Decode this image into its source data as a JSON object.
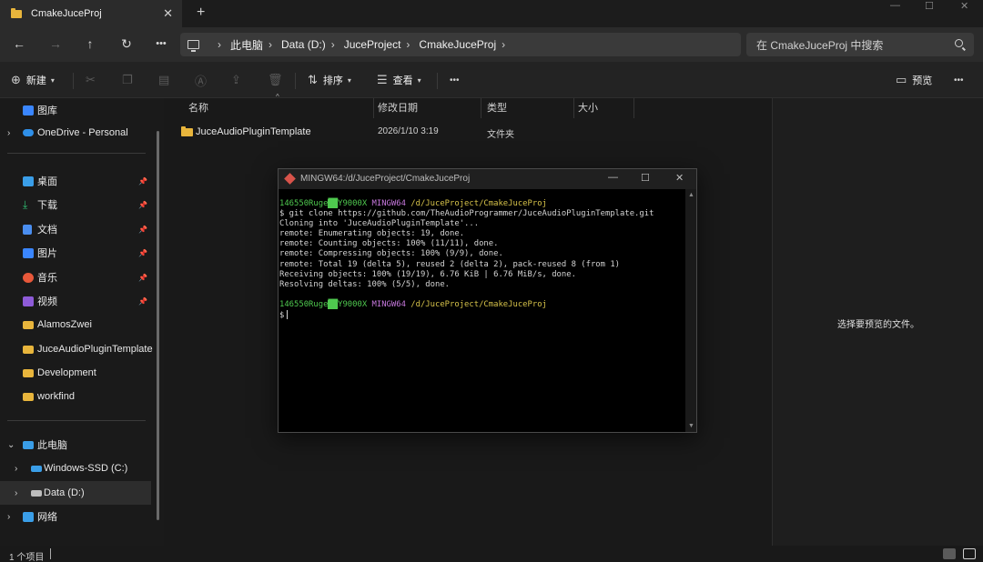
{
  "tab": {
    "title": "CmakeJuceProj",
    "close": "✕",
    "new": "+"
  },
  "window_controls": {
    "minimize": "—",
    "maximize": "☐",
    "close": "✕"
  },
  "nav": {
    "back": "←",
    "forward": "→",
    "up": "↑",
    "refresh": "↻",
    "more": "•••"
  },
  "breadcrumbs": [
    "此电脑",
    "Data (D:)",
    "JuceProject",
    "CmakeJuceProj"
  ],
  "search": {
    "placeholder": "在 CmakeJuceProj 中搜索"
  },
  "toolbar": {
    "new_label": "新建",
    "sort_label": "排序",
    "view_label": "查看",
    "preview_label": "预览",
    "more": "•••"
  },
  "sidebar": {
    "items": [
      {
        "label": "图库",
        "icon": "gallery-icon",
        "color": "#3a86ff"
      },
      {
        "label": "OneDrive - Personal",
        "icon": "cloud-icon",
        "color": "#2f8fe8"
      },
      {
        "label": "桌面",
        "icon": "desktop-icon",
        "color": "#3a9ee8",
        "pinned": true
      },
      {
        "label": "下载",
        "icon": "download-icon",
        "color": "#2fbf71",
        "pinned": true
      },
      {
        "label": "文档",
        "icon": "document-icon",
        "color": "#4a8ef0",
        "pinned": true
      },
      {
        "label": "图片",
        "icon": "picture-icon",
        "color": "#3a86ff",
        "pinned": true
      },
      {
        "label": "音乐",
        "icon": "music-icon",
        "color": "#e8583a",
        "pinned": true
      },
      {
        "label": "视频",
        "icon": "video-icon",
        "color": "#8e5bd8",
        "pinned": true
      },
      {
        "label": "AlamosZwei",
        "icon": "folder-icon",
        "color": "#e8b53c"
      },
      {
        "label": "JuceAudioPluginTemplate",
        "icon": "folder-icon",
        "color": "#e8b53c"
      },
      {
        "label": "Development",
        "icon": "folder-icon",
        "color": "#e8b53c"
      },
      {
        "label": "workfind",
        "icon": "folder-icon",
        "color": "#e8b53c"
      },
      {
        "label": "此电脑",
        "icon": "computer-icon",
        "color": "#3a9ee8"
      },
      {
        "label": "Windows-SSD (C:)",
        "icon": "drive-icon",
        "color": "#3a9ee8"
      },
      {
        "label": "Data (D:)",
        "icon": "drive-icon",
        "color": "#bdbdbd"
      },
      {
        "label": "网络",
        "icon": "network-icon",
        "color": "#3a9ee8"
      }
    ]
  },
  "columns": [
    "名称",
    "修改日期",
    "类型",
    "大小"
  ],
  "files": [
    {
      "name": "JuceAudioPluginTemplate",
      "modified": "2026/1/10 3:19",
      "type": "文件夹",
      "size": ""
    }
  ],
  "preview": {
    "message": "选择要预览的文件。"
  },
  "status": {
    "count": "1 个项目"
  },
  "terminal": {
    "title": "MINGW64:/d/JuceProject/CmakeJuceProj",
    "prompt_user": "146550Ruge",
    "prompt_host_highlight": "Y9000X",
    "prompt_env": "MINGW64",
    "prompt_path": "/d/JuceProject/CmakeJuceProj",
    "lines": [
      "$ git clone https://github.com/TheAudioProgrammer/JuceAudioPluginTemplate.git",
      "Cloning into 'JuceAudioPluginTemplate'...",
      "remote: Enumerating objects: 19, done.",
      "remote: Counting objects: 100% (11/11), done.",
      "remote: Compressing objects: 100% (9/9), done.",
      "remote: Total 19 (delta 5), reused 2 (delta 2), pack-reused 8 (from 1)",
      "Receiving objects: 100% (19/19), 6.76 KiB | 6.76 MiB/s, done.",
      "Resolving deltas: 100% (5/5), done."
    ],
    "final_prompt": "$"
  }
}
